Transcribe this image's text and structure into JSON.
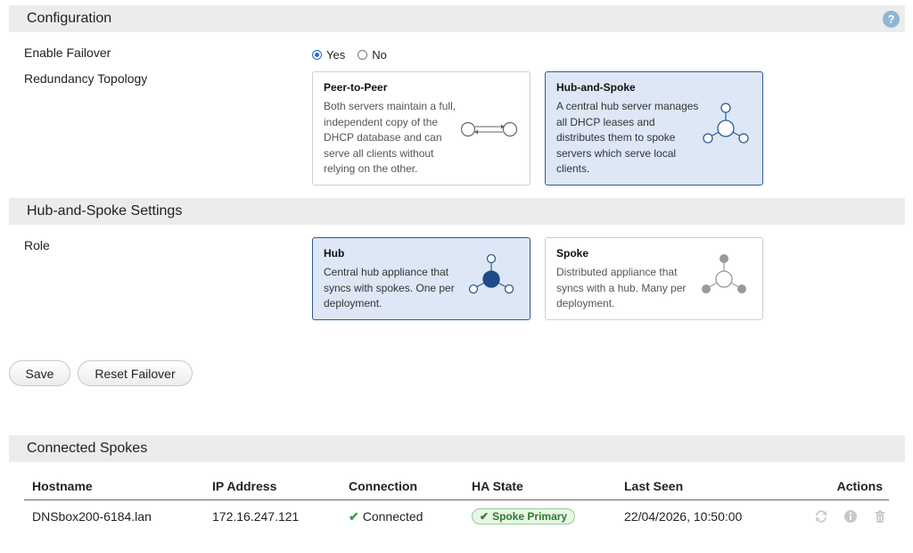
{
  "configuration": {
    "title": "Configuration",
    "help_icon": "question-circle-icon",
    "enable_failover": {
      "label": "Enable Failover",
      "options": [
        "Yes",
        "No"
      ],
      "selected": "Yes"
    },
    "redundancy_topology": {
      "label": "Redundancy Topology",
      "selected": "Hub-and-Spoke",
      "options": [
        {
          "title": "Peer-to-Peer",
          "description": "Both servers maintain a full, independent copy of the DHCP database and can serve all clients without relying on the other.",
          "icon": "peer-to-peer-icon"
        },
        {
          "title": "Hub-and-Spoke",
          "description": "A central hub server manages all DHCP leases and distributes them to spoke servers which serve local clients.",
          "icon": "hub-and-spoke-icon"
        }
      ]
    }
  },
  "hub_spoke_settings": {
    "title": "Hub-and-Spoke Settings",
    "role": {
      "label": "Role",
      "selected": "Hub",
      "options": [
        {
          "title": "Hub",
          "description": "Central hub appliance that syncs with spokes. One per deployment.",
          "icon": "hub-icon"
        },
        {
          "title": "Spoke",
          "description": "Distributed appliance that syncs with a hub. Many per deployment.",
          "icon": "spoke-icon"
        }
      ]
    }
  },
  "buttons": {
    "save": "Save",
    "reset_failover": "Reset Failover"
  },
  "connected_spokes": {
    "title": "Connected Spokes",
    "columns": [
      "Hostname",
      "IP Address",
      "Connection",
      "HA State",
      "Last Seen",
      "Actions"
    ],
    "rows": [
      {
        "hostname": "DNSbox200-6184.lan",
        "ip": "172.16.247.121",
        "connection": "Connected",
        "ha_state": "Spoke Primary",
        "last_seen": "22/04/2026, 10:50:00",
        "actions": [
          "refresh-icon",
          "info-icon",
          "trash-icon"
        ]
      }
    ]
  },
  "colors": {
    "accent": "#2d5b94",
    "selected_bg": "#dde7f5",
    "success": "#3aa34a"
  }
}
